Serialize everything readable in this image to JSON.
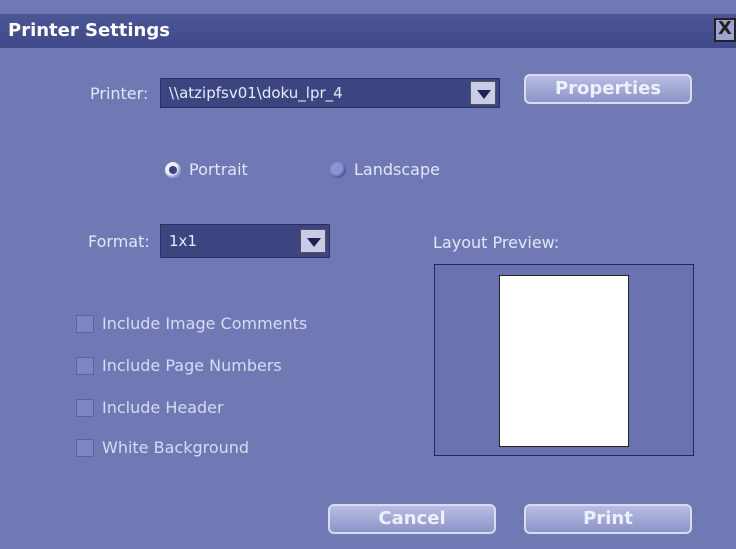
{
  "window": {
    "title": "Printer Settings",
    "close_label": "X"
  },
  "printer": {
    "label": "Printer:",
    "value": "\\\\atzipfsv01\\doku_lpr_4"
  },
  "properties_button": "Properties",
  "orientation": {
    "portrait_label": "Portrait",
    "landscape_label": "Landscape",
    "selected": "Portrait"
  },
  "format": {
    "label": "Format:",
    "value": "1x1"
  },
  "layout_preview": {
    "label": "Layout Preview:"
  },
  "options": [
    {
      "label": "Include Image Comments",
      "checked": false
    },
    {
      "label": "Include Page Numbers",
      "checked": false
    },
    {
      "label": "Include Header",
      "checked": false
    },
    {
      "label": "White Background",
      "checked": false
    }
  ],
  "buttons": {
    "cancel": "Cancel",
    "print": "Print"
  },
  "colors": {
    "background": "#7179b5",
    "titlebar": "#3f4888",
    "combo": "#3d4581"
  }
}
